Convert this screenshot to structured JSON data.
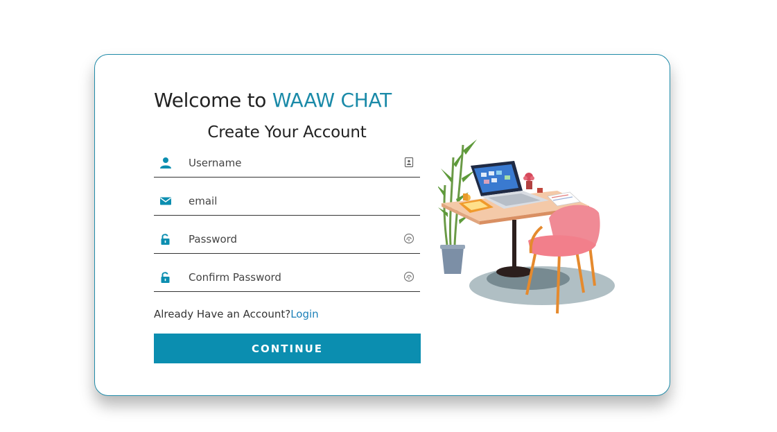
{
  "header": {
    "welcome_prefix": "Welcome to ",
    "brand_name": "WAAW CHAT",
    "subtitle": "Create Your Account"
  },
  "form": {
    "username": {
      "placeholder": "Username",
      "value": "",
      "lead_icon": "user-icon",
      "trail_icon": "contact-card-icon"
    },
    "email": {
      "placeholder": "email",
      "value": "",
      "lead_icon": "envelope-icon"
    },
    "password": {
      "placeholder": "Password",
      "value": "",
      "lead_icon": "unlock-icon",
      "trail_icon": "fingerprint-icon"
    },
    "confirm_password": {
      "placeholder": "Confirm Password",
      "value": "",
      "lead_icon": "unlock-icon",
      "trail_icon": "fingerprint-icon"
    }
  },
  "account": {
    "prompt": "Already Have an Account?",
    "login_label": "Login"
  },
  "actions": {
    "continue_label": "CONTINUE"
  },
  "colors": {
    "accent": "#0b8eb0",
    "brand_text": "#1a8aa8",
    "link": "#1a7fb8",
    "card_border": "#1f8aa8",
    "chair": "#f07f8c",
    "desk_top": "#f4c9a8"
  },
  "illustration": {
    "description_icon": "workspace-desk-illustration"
  }
}
